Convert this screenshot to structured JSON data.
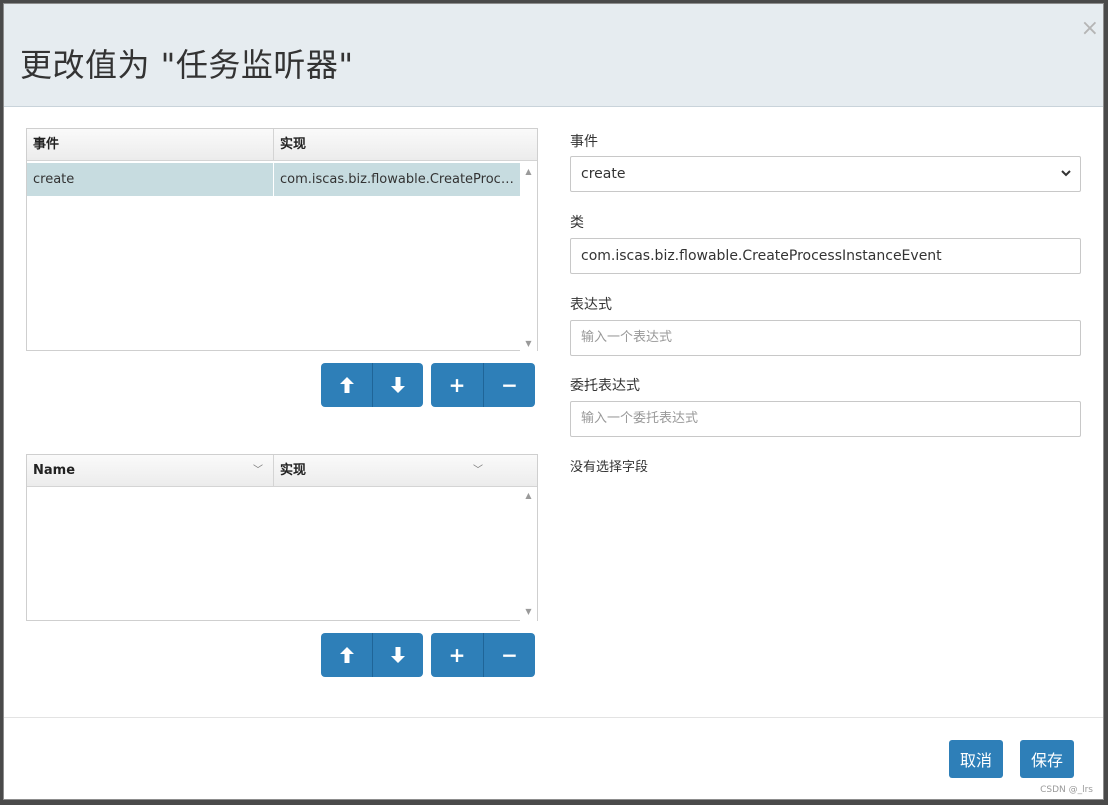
{
  "dialog": {
    "title": "更改值为 \"任务监听器\"",
    "close_glyph": "×"
  },
  "listener_grid": {
    "columns": [
      "事件",
      "实现"
    ],
    "rows": [
      {
        "event": "create",
        "implementation": "com.iscas.biz.flowable.CreateProces..."
      }
    ]
  },
  "field_grid": {
    "columns": [
      "Name",
      "实现"
    ]
  },
  "buttons": {
    "move_up": "🡅",
    "move_down": "🡇",
    "add": "+",
    "remove": "−"
  },
  "form": {
    "event_label": "事件",
    "event_value": "create",
    "class_label": "类",
    "class_value": "com.iscas.biz.flowable.CreateProcessInstanceEvent",
    "expression_label": "表达式",
    "expression_placeholder": "输入一个表达式",
    "delegate_label": "委托表达式",
    "delegate_placeholder": "输入一个委托表达式",
    "no_field_text": "没有选择字段"
  },
  "footer": {
    "cancel_label": "取消",
    "save_label": "保存"
  },
  "watermark": "CSDN @_lrs",
  "colors": {
    "primary": "#2e7fb8",
    "header_bg": "#e6ecf0",
    "selected_row": "#c7dce0"
  }
}
